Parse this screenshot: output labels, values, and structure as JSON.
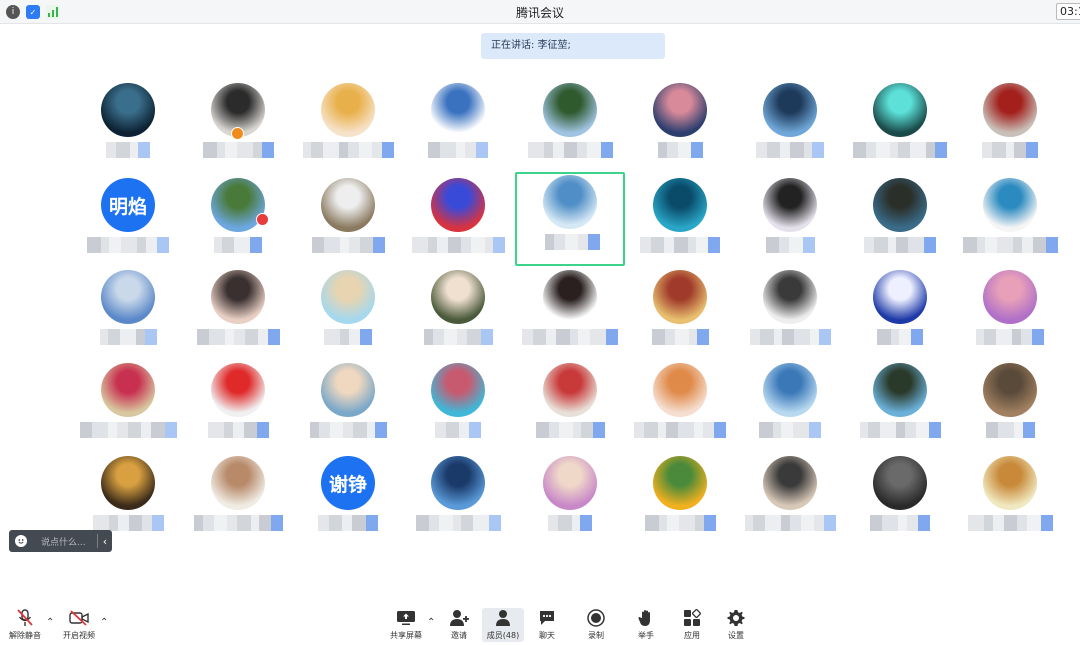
{
  "window": {
    "title": "腾讯会议",
    "time": "03:1"
  },
  "banner": {
    "speaking_text": "正在讲话: 李征堃;"
  },
  "participants": [
    {
      "row": 0,
      "col": 0,
      "avatar": "image",
      "colors": [
        "#0d2233",
        "#3a6f8c"
      ]
    },
    {
      "row": 0,
      "col": 1,
      "avatar": "image",
      "colors": [
        "#d9d6d2",
        "#2b2b2b"
      ],
      "badge": "host"
    },
    {
      "row": 0,
      "col": 2,
      "avatar": "image",
      "colors": [
        "#f6e2c8",
        "#e8b04a"
      ]
    },
    {
      "row": 0,
      "col": 3,
      "avatar": "image",
      "colors": [
        "#ffffff",
        "#3a72c0"
      ]
    },
    {
      "row": 0,
      "col": 4,
      "avatar": "image",
      "colors": [
        "#9fc3e0",
        "#2f5a2e"
      ]
    },
    {
      "row": 0,
      "col": 5,
      "avatar": "image",
      "colors": [
        "#2b3e6e",
        "#d88a9a"
      ]
    },
    {
      "row": 0,
      "col": 6,
      "avatar": "image",
      "colors": [
        "#6fa7d8",
        "#1e3a5a"
      ]
    },
    {
      "row": 0,
      "col": 7,
      "avatar": "image",
      "colors": [
        "#1a4a4a",
        "#5ce0d8"
      ]
    },
    {
      "row": 0,
      "col": 8,
      "avatar": "image",
      "colors": [
        "#c8c0b8",
        "#a3201c"
      ]
    },
    {
      "row": 1,
      "col": 0,
      "avatar": "text",
      "text": "明焰"
    },
    {
      "row": 1,
      "col": 1,
      "avatar": "image",
      "colors": [
        "#6da7df",
        "#4a7a3a"
      ],
      "badge": "red"
    },
    {
      "row": 1,
      "col": 2,
      "avatar": "image",
      "colors": [
        "#8a7a60",
        "#eeeeee"
      ]
    },
    {
      "row": 1,
      "col": 3,
      "avatar": "image",
      "colors": [
        "#d8333f",
        "#3a4ad8"
      ]
    },
    {
      "row": 1,
      "col": 4,
      "avatar": "image",
      "colors": [
        "#d5e8f5",
        "#4f8ec6"
      ],
      "selected": true
    },
    {
      "row": 1,
      "col": 5,
      "avatar": "image",
      "colors": [
        "#2aa7c8",
        "#0a4b6a"
      ]
    },
    {
      "row": 1,
      "col": 6,
      "avatar": "image",
      "colors": [
        "#e5e1ec",
        "#222222"
      ]
    },
    {
      "row": 1,
      "col": 7,
      "avatar": "image",
      "colors": [
        "#3a6c8a",
        "#2b2f2a"
      ]
    },
    {
      "row": 1,
      "col": 8,
      "avatar": "image",
      "colors": [
        "#f5f5f5",
        "#2b8ac0"
      ]
    },
    {
      "row": 2,
      "col": 0,
      "avatar": "image",
      "colors": [
        "#5b88c8",
        "#c9d9ea"
      ]
    },
    {
      "row": 2,
      "col": 1,
      "avatar": "image",
      "colors": [
        "#e9d0c4",
        "#3a3030"
      ]
    },
    {
      "row": 2,
      "col": 2,
      "avatar": "image",
      "colors": [
        "#a5d8ee",
        "#e8d4b0"
      ]
    },
    {
      "row": 2,
      "col": 3,
      "avatar": "image",
      "colors": [
        "#4a5a3a",
        "#f0e0d0"
      ]
    },
    {
      "row": 2,
      "col": 4,
      "avatar": "image",
      "colors": [
        "#ffffff",
        "#2a2020"
      ]
    },
    {
      "row": 2,
      "col": 5,
      "avatar": "image",
      "colors": [
        "#e8c070",
        "#a03a2a"
      ]
    },
    {
      "row": 2,
      "col": 6,
      "avatar": "image",
      "colors": [
        "#eeeeee",
        "#3a3a3a"
      ]
    },
    {
      "row": 2,
      "col": 7,
      "avatar": "image",
      "colors": [
        "#1e3aa8",
        "#eef0ff"
      ]
    },
    {
      "row": 2,
      "col": 8,
      "avatar": "image",
      "colors": [
        "#b070c8",
        "#e8a0b8"
      ]
    },
    {
      "row": 3,
      "col": 0,
      "avatar": "image",
      "colors": [
        "#d8c8a0",
        "#c83050"
      ]
    },
    {
      "row": 3,
      "col": 1,
      "avatar": "image",
      "colors": [
        "#f0f0f0",
        "#e02a2a"
      ]
    },
    {
      "row": 3,
      "col": 2,
      "avatar": "image",
      "colors": [
        "#7aa8c8",
        "#f0d8c0"
      ]
    },
    {
      "row": 3,
      "col": 3,
      "avatar": "image",
      "colors": [
        "#3fb8d8",
        "#c85a70"
      ]
    },
    {
      "row": 3,
      "col": 4,
      "avatar": "image",
      "colors": [
        "#e8e0d8",
        "#c83a3a"
      ]
    },
    {
      "row": 3,
      "col": 5,
      "avatar": "image",
      "colors": [
        "#f5ded0",
        "#e08a4a"
      ]
    },
    {
      "row": 3,
      "col": 6,
      "avatar": "image",
      "colors": [
        "#b8d8f0",
        "#3a78b8"
      ]
    },
    {
      "row": 3,
      "col": 7,
      "avatar": "image",
      "colors": [
        "#6ab0d8",
        "#2a3a2a"
      ]
    },
    {
      "row": 3,
      "col": 8,
      "avatar": "image",
      "colors": [
        "#a08060",
        "#5a4a3a"
      ]
    },
    {
      "row": 4,
      "col": 0,
      "avatar": "image",
      "colors": [
        "#3a2a1a",
        "#d8a040"
      ]
    },
    {
      "row": 4,
      "col": 1,
      "avatar": "image",
      "colors": [
        "#f0ece4",
        "#b88a6a"
      ]
    },
    {
      "row": 4,
      "col": 2,
      "avatar": "text",
      "text": "谢铮"
    },
    {
      "row": 4,
      "col": 3,
      "avatar": "image",
      "colors": [
        "#5a9ad8",
        "#1a3a6a"
      ]
    },
    {
      "row": 4,
      "col": 4,
      "avatar": "image",
      "colors": [
        "#c888c8",
        "#f0d8c8"
      ]
    },
    {
      "row": 4,
      "col": 5,
      "avatar": "image",
      "colors": [
        "#f0b020",
        "#4a8a3a"
      ]
    },
    {
      "row": 4,
      "col": 6,
      "avatar": "image",
      "colors": [
        "#d8c8b8",
        "#3a3a3a"
      ]
    },
    {
      "row": 4,
      "col": 7,
      "avatar": "image",
      "colors": [
        "#2a2a2a",
        "#6a6a6a"
      ]
    },
    {
      "row": 4,
      "col": 8,
      "avatar": "image",
      "colors": [
        "#f0e8c0",
        "#c88a3a"
      ]
    }
  ],
  "chat": {
    "placeholder": "说点什么..."
  },
  "toolbar": {
    "unmute": "解除静音",
    "start_video": "开启视频",
    "share_screen": "共享屏幕",
    "invite": "邀请",
    "members": "成员(48)",
    "chat": "聊天",
    "record": "录制",
    "raise_hand": "举手",
    "apps": "应用",
    "settings": "设置"
  },
  "colors": {
    "accent": "#1d72f2",
    "selected_border": "#3bd48a",
    "mute_red": "#e0343a",
    "banner_bg": "#dbe9fb"
  }
}
